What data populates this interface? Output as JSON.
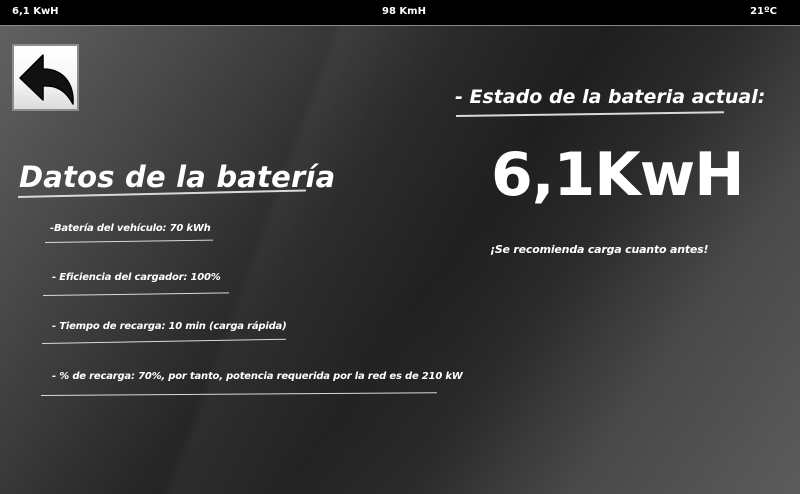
{
  "status_bar": {
    "energy": "6,1 KwH",
    "speed": "98 KmH",
    "temperature": "21ºC"
  },
  "back_button": {
    "icon": "back-arrow-icon"
  },
  "battery_data": {
    "title": "Datos de la batería",
    "items": [
      {
        "label": "-Batería del vehículo: 70 kWh"
      },
      {
        "label": "- Eficiencia del cargador: 100%"
      },
      {
        "label": "- Tiempo de recarga: 10 min (carga rápida)"
      },
      {
        "label": "- % de recarga: 70%, por tanto, potencia requerida por la red es de 210 kW"
      }
    ]
  },
  "battery_state": {
    "title": "- Estado de la bateria actual:",
    "value": "6,1KwH",
    "recommendation": "¡Se recomienda carga cuanto antes!"
  },
  "colors": {
    "status_bar_background": "#000000",
    "text": "#ffffff",
    "underline": "#d9d9d9",
    "background_dark": "#1f1f20",
    "background_light": "#636363"
  }
}
